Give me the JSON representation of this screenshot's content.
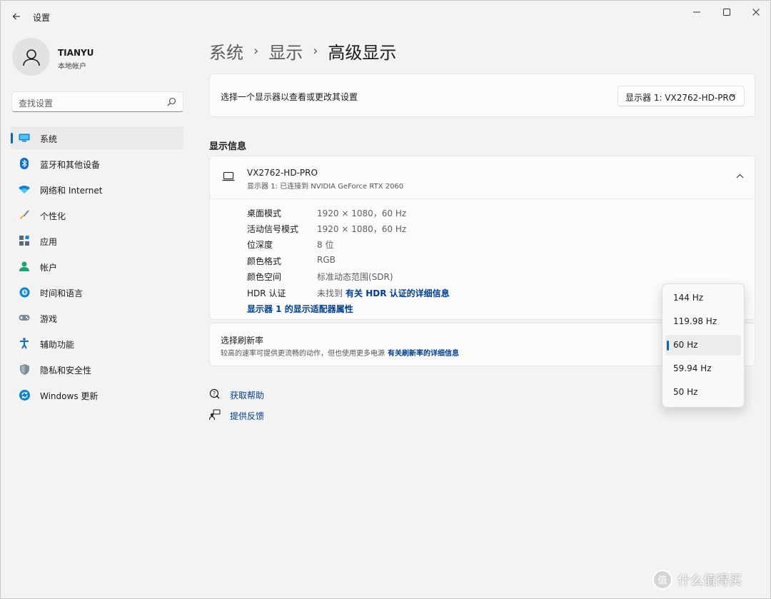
{
  "window": {
    "title": "设置"
  },
  "profile": {
    "name": "TIANYU",
    "account_type": "本地帐户"
  },
  "search": {
    "placeholder": "查找设置"
  },
  "sidebar": {
    "items": [
      {
        "label": "系统",
        "icon": "system-icon",
        "active": true
      },
      {
        "label": "蓝牙和其他设备",
        "icon": "bluetooth-icon"
      },
      {
        "label": "网络和 Internet",
        "icon": "wifi-icon"
      },
      {
        "label": "个性化",
        "icon": "brush-icon"
      },
      {
        "label": "应用",
        "icon": "apps-icon"
      },
      {
        "label": "帐户",
        "icon": "account-icon"
      },
      {
        "label": "时间和语言",
        "icon": "time-language-icon"
      },
      {
        "label": "游戏",
        "icon": "gamepad-icon"
      },
      {
        "label": "辅助功能",
        "icon": "accessibility-icon"
      },
      {
        "label": "隐私和安全性",
        "icon": "shield-icon"
      },
      {
        "label": "Windows 更新",
        "icon": "windows-update-icon"
      }
    ]
  },
  "breadcrumb": {
    "level1": "系统",
    "level2": "显示",
    "current": "高级显示",
    "separator": "›"
  },
  "display_select": {
    "label": "选择一个显示器以查看或更改其设置",
    "selected": "显示器 1: VX2762-HD-PRO"
  },
  "display_info": {
    "section_title": "显示信息",
    "monitor_name": "VX2762-HD-PRO",
    "monitor_sub": "显示器 1: 已连接到 NVIDIA GeForce RTX 2060",
    "rows": [
      {
        "key": "桌面模式",
        "value": "1920 × 1080，60 Hz"
      },
      {
        "key": "活动信号模式",
        "value": "1920 × 1080，60 Hz"
      },
      {
        "key": "位深度",
        "value": "8 位"
      },
      {
        "key": "颜色格式",
        "value": "RGB"
      },
      {
        "key": "颜色空间",
        "value": "标准动态范围(SDR)"
      },
      {
        "key": "HDR 认证",
        "value": "未找到",
        "link": "有关 HDR 认证的详细信息"
      }
    ],
    "adapter_link": "显示器 1 的显示适配器属性"
  },
  "refresh": {
    "title": "选择刷新率",
    "description": "较高的速率可提供更流畅的动作，但也使用更多电源",
    "link": "有关刷新率的详细信息",
    "options": [
      "144 Hz",
      "119.98 Hz",
      "60 Hz",
      "59.94 Hz",
      "50 Hz"
    ],
    "selected": "60 Hz"
  },
  "help": {
    "get_help": "获取帮助",
    "feedback": "提供反馈"
  },
  "watermark": {
    "text": "什么值得买",
    "mark": "值"
  },
  "colors": {
    "accent": "#0067c0",
    "link": "#003e92",
    "background": "#f3f3f3",
    "card": "#fbfbfb"
  }
}
